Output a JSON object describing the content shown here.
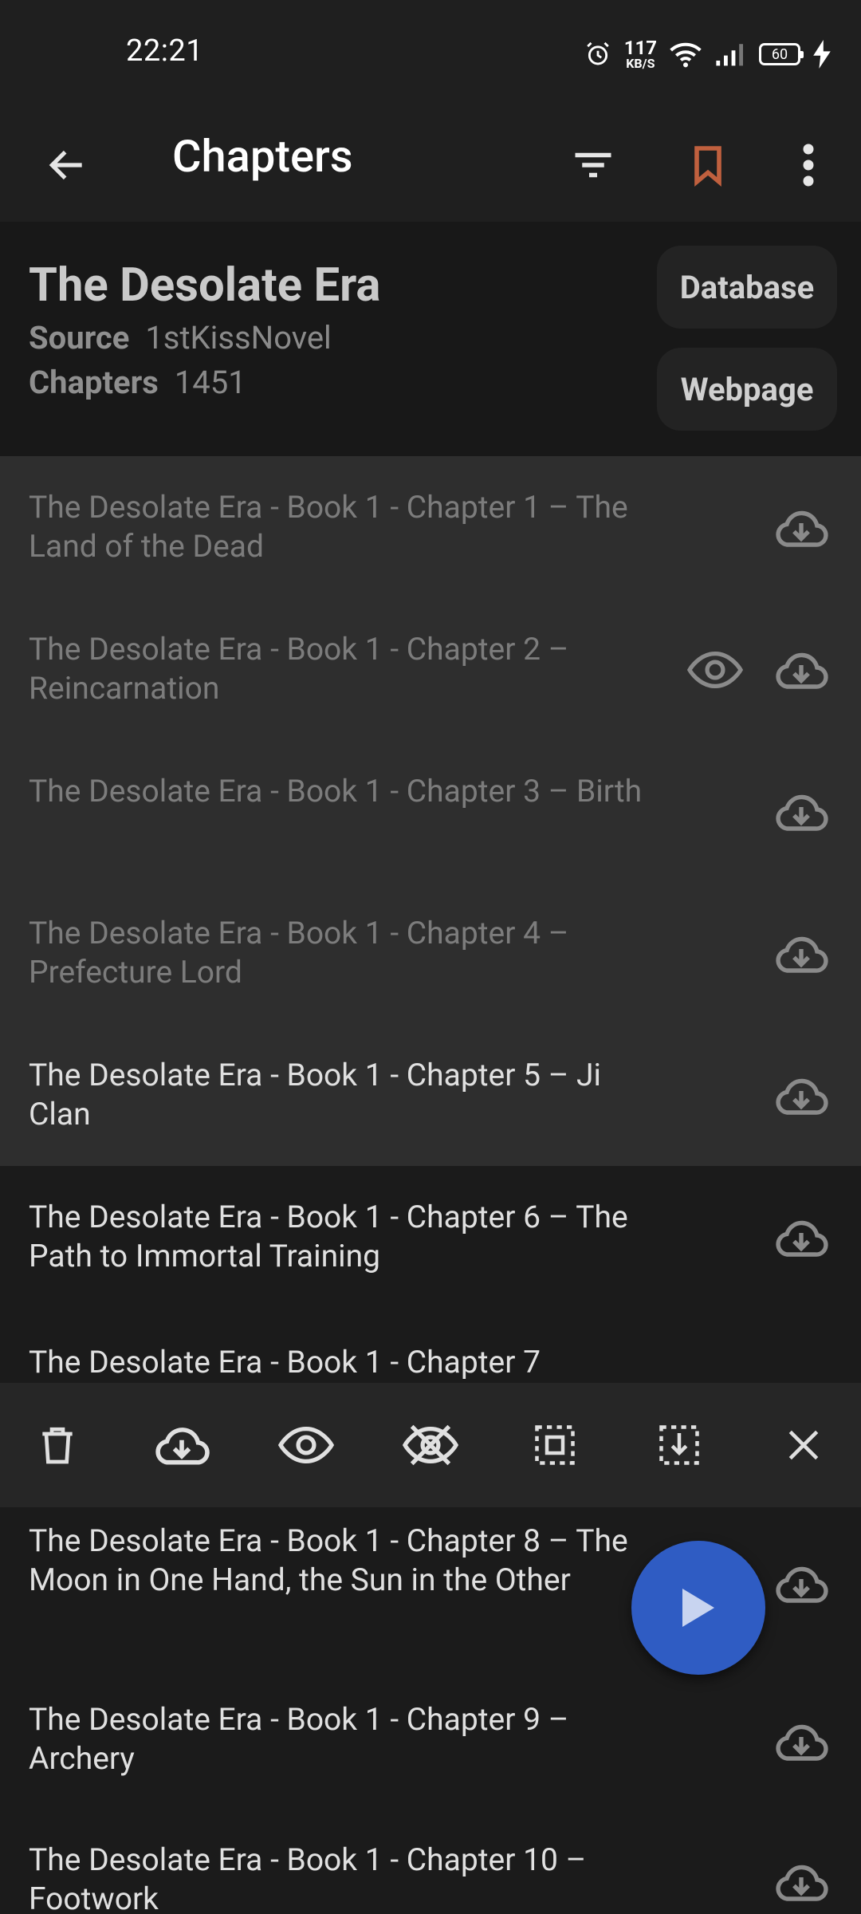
{
  "status_bar": {
    "time": "22:21",
    "net_speed_value": "117",
    "net_speed_unit": "KB/S",
    "battery": "60"
  },
  "app_bar": {
    "title": "Chapters"
  },
  "novel": {
    "title": "The Desolate Era",
    "source_label": "Source",
    "source_value": "1stKissNovel",
    "chapters_label": "Chapters",
    "chapters_value": "1451",
    "database_button": "Database",
    "webpage_button": "Webpage"
  },
  "chapters": [
    {
      "title": "The Desolate Era - Book 1 - Chapter 1 – The Land of the Dead"
    },
    {
      "title": "The Desolate Era - Book 1 - Chapter 2 – Reincarnation"
    },
    {
      "title": "The Desolate Era - Book 1 - Chapter 3 – Birth"
    },
    {
      "title": "The Desolate Era - Book 1 - Chapter 4 – Prefecture Lord"
    },
    {
      "title": "The Desolate Era - Book 1 - Chapter 5 – Ji Clan"
    },
    {
      "title": "The Desolate Era - Book 1 - Chapter 6 – The Path to Immortal Training"
    },
    {
      "title": "The Desolate Era - Book 1 - Chapter 7"
    },
    {
      "title": "The Desolate Era - Book 1 - Chapter 8 – The Moon in One Hand, the Sun in the Other"
    },
    {
      "title": "The Desolate Era - Book 1 - Chapter 9 – Archery"
    },
    {
      "title": "The Desolate Era - Book 1 - Chapter 10 – Footwork"
    }
  ],
  "colors": {
    "bookmark": "#c0603e",
    "fab": "#2f5cc3",
    "selected_row": "#2e2e2e"
  },
  "icons": {
    "back": "arrow-left-icon",
    "filter": "filter-icon",
    "bookmark": "bookmark-icon",
    "more": "more-vert-icon",
    "download": "cloud-download-icon",
    "eye": "eye-icon",
    "delete": "trash-icon",
    "unread": "eye-off-icon",
    "select_all": "select-all-icon",
    "select_below": "select-below-icon",
    "close": "close-icon",
    "play": "play-icon"
  }
}
